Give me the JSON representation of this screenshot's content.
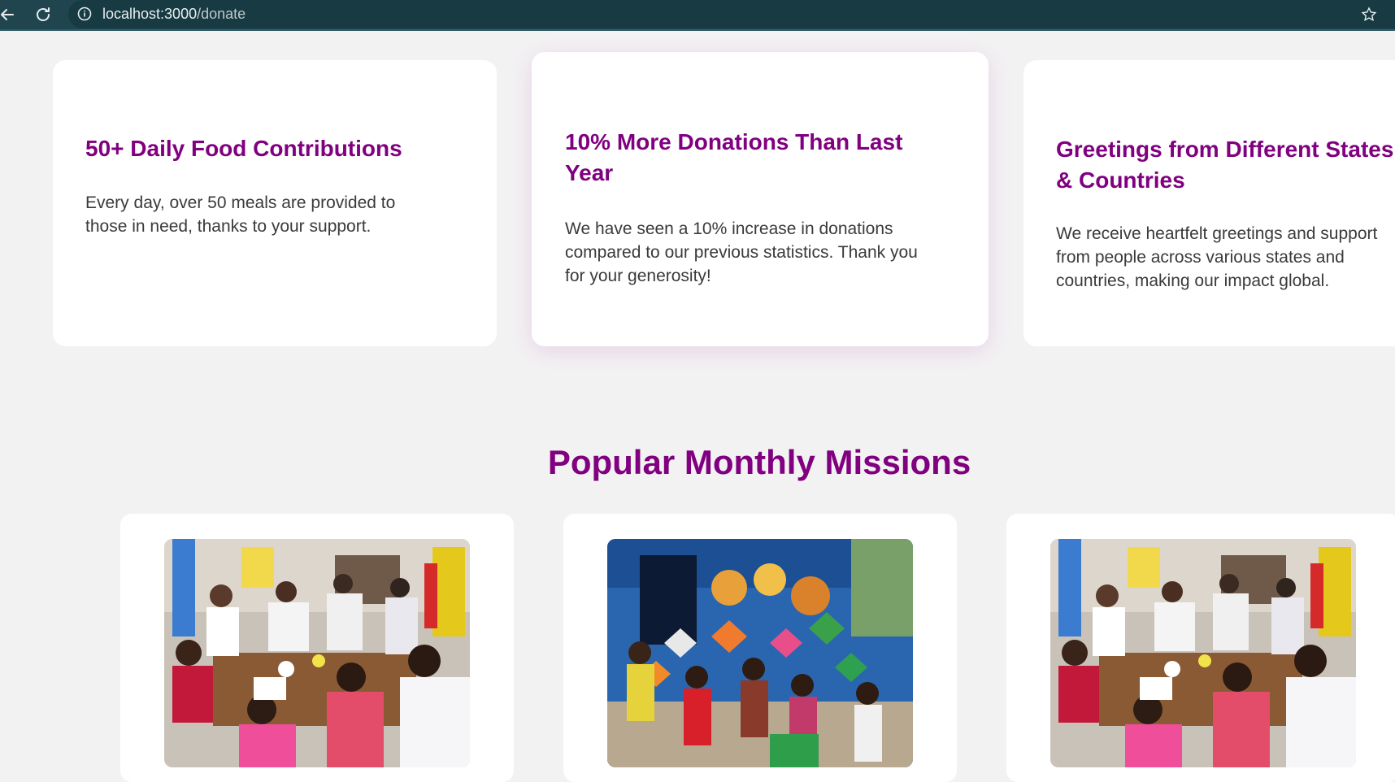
{
  "browser": {
    "url_host": "localhost:3000",
    "url_path": "/donate"
  },
  "stats": [
    {
      "title": "50+ Daily Food Contributions",
      "text": "Every day, over 50 meals are provided to those in need, thanks to your support."
    },
    {
      "title": "10% More Donations Than Last Year",
      "text": "We have seen a 10% increase in donations compared to our previous statistics. Thank you for your generosity!"
    },
    {
      "title": "Greetings from Different States & Countries",
      "text": "We receive heartfelt greetings and support from people across various states and countries, making our impact global."
    }
  ],
  "missions": {
    "title": "Popular Monthly Missions"
  },
  "colors": {
    "accent": "#800080",
    "page_bg": "#f3f2f3",
    "chrome_bg": "#21454f"
  }
}
